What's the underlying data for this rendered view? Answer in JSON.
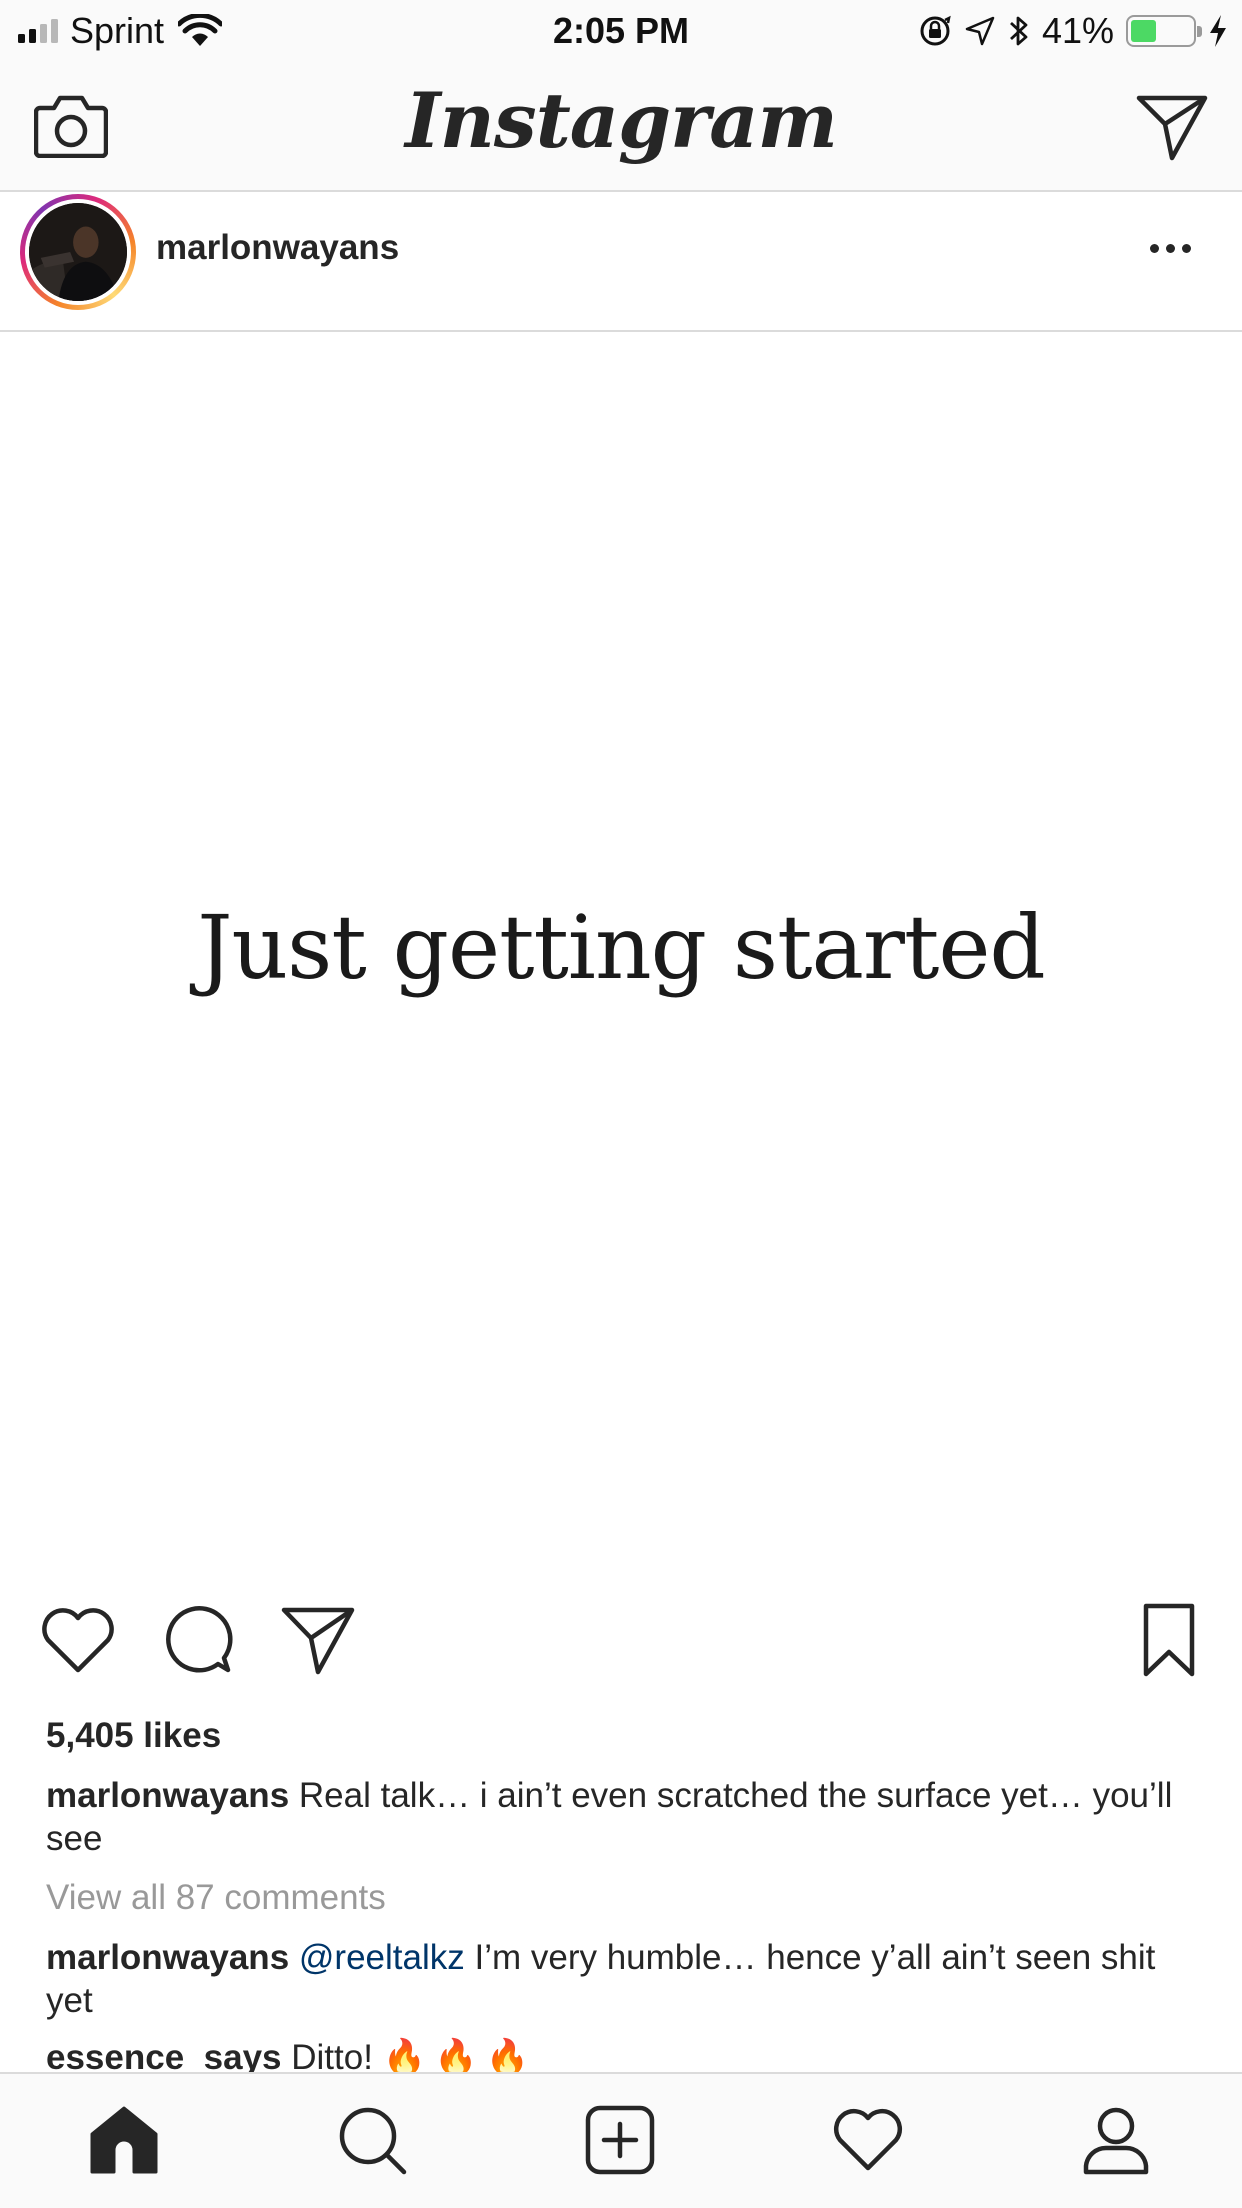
{
  "status_bar": {
    "carrier": "Sprint",
    "time": "2:05 PM",
    "battery_percent": "41%",
    "battery_level": 0.41,
    "signal_bars_active": 2,
    "signal_bars_total": 4
  },
  "nav": {
    "logo": "Instagram",
    "left_icon": "camera-icon",
    "right_icon": "direct-message-icon"
  },
  "post": {
    "username": "marlonwayans",
    "image_text": "Just getting started",
    "likes": "5,405 likes",
    "caption": {
      "username": "marlonwayans",
      "text": "Real talk… i ain’t even scratched the surface yet… you’ll see"
    },
    "view_all_comments": "View all 87 comments",
    "comments": [
      {
        "username": "marlonwayans",
        "mention": "@reeltalkz",
        "text": "I’m very humble… hence y’all ain’t seen shit yet"
      },
      {
        "username": "essence_says",
        "text": "Ditto!",
        "emoji": "🔥🔥🔥"
      }
    ]
  },
  "tab_bar": {
    "items": [
      "home-icon",
      "search-icon",
      "new-post-icon",
      "activity-icon",
      "profile-icon"
    ]
  },
  "colors": {
    "text": "#262626",
    "muted": "#999999",
    "mention": "#003569",
    "border": "#dbdbdb",
    "battery": "#4cd964"
  }
}
